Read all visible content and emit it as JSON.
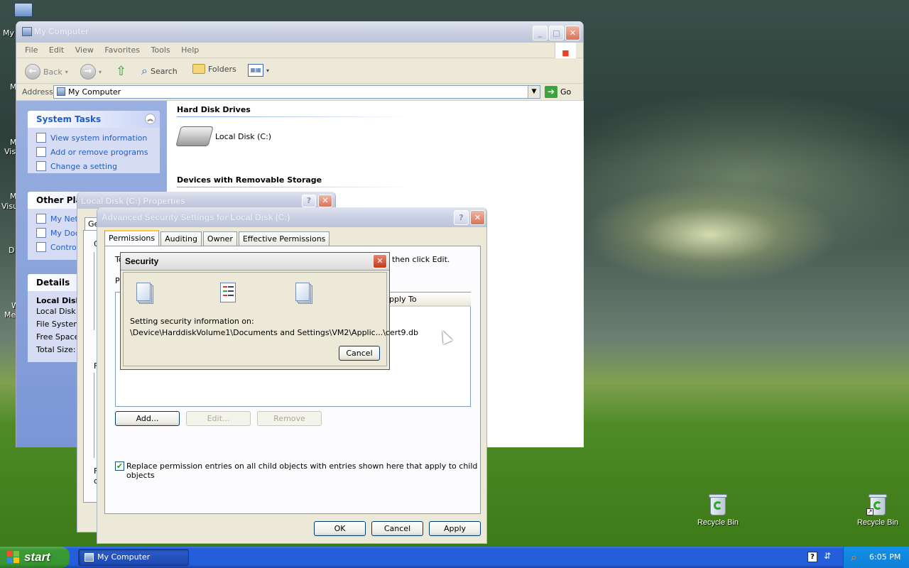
{
  "desktop": {
    "icons": [
      {
        "label": "Recycle Bin"
      },
      {
        "label": "Recycle Bin"
      }
    ],
    "partial_labels": [
      "My",
      "M",
      "M",
      "Visu",
      "M",
      "Visu",
      "D",
      "W",
      "Me"
    ]
  },
  "my_computer": {
    "title": "My Computer",
    "menu": [
      "File",
      "Edit",
      "View",
      "Favorites",
      "Tools",
      "Help"
    ],
    "toolbar": {
      "back": "Back",
      "search": "Search",
      "folders": "Folders"
    },
    "address_label": "Address",
    "address_value": "My Computer",
    "go_label": "Go",
    "system_tasks": {
      "title": "System Tasks",
      "items": [
        "View system information",
        "Add or remove programs",
        "Change a setting"
      ]
    },
    "other_places": {
      "title": "Other Plac",
      "items": [
        "My Net",
        "My Doc",
        "Contro"
      ]
    },
    "details": {
      "title": "Details",
      "name": "Local Disk",
      "type": "Local Disk",
      "lines": [
        "File System",
        "Free Space",
        "Total Size: "
      ]
    },
    "sections": {
      "hard_disks": "Hard Disk Drives",
      "removable": "Devices with Removable Storage"
    },
    "local_disk_label": "Local Disk (C:)"
  },
  "local_disk_props": {
    "title": "Local Disk (C:) Properties",
    "tab_partial": "Ge",
    "fragments": [
      "G",
      "T",
      "P",
      "F",
      "F",
      "c"
    ]
  },
  "adv_security": {
    "title": "Advanced Security Settings for Local Disk (C:)",
    "tabs": [
      "Permissions",
      "Auditing",
      "Owner",
      "Effective Permissions"
    ],
    "instruction_tail": "then click Edit.",
    "instruction_head": "To",
    "list_label": "Pe",
    "column_apply_to": "pply To",
    "buttons": {
      "add": "Add...",
      "edit": "Edit...",
      "remove": "Remove"
    },
    "replace_checkbox": "Replace permission entries on all child objects with entries shown here that apply to child objects",
    "replace_checked": true,
    "footer": {
      "ok": "OK",
      "cancel": "Cancel",
      "apply": "Apply"
    }
  },
  "security_dialog": {
    "title": "Security",
    "line1": "Setting security information on:",
    "line2": "\\Device\\HarddiskVolume1\\Documents and Settings\\VM2\\Applic...\\cert9.db",
    "cancel": "Cancel"
  },
  "taskbar": {
    "start": "start",
    "window_button": "My Computer",
    "time": "6:05 PM"
  }
}
